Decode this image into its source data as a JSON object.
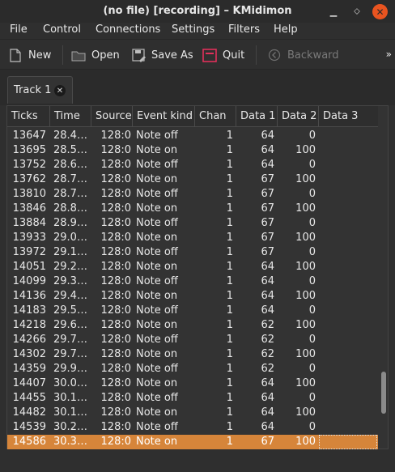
{
  "window": {
    "title": "(no file) [recording] – KMidimon"
  },
  "menu": [
    "File",
    "Control",
    "Connections",
    "Settings",
    "Filters",
    "Help"
  ],
  "toolbar": {
    "new_label": "New",
    "open_label": "Open",
    "saveas_label": "Save As",
    "quit_label": "Quit",
    "backward_label": "Backward",
    "more_label": "»"
  },
  "tab": {
    "label": "Track 1"
  },
  "table": {
    "headers": [
      "Ticks",
      "Time",
      "Source",
      "Event kind",
      "Chan",
      "Data 1",
      "Data 2",
      "Data 3"
    ],
    "rows": [
      [
        "13647",
        "28.4…",
        "128:0",
        "Note off",
        "1",
        "64",
        "0",
        ""
      ],
      [
        "13695",
        "28.5…",
        "128:0",
        "Note on",
        "1",
        "64",
        "100",
        ""
      ],
      [
        "13752",
        "28.6…",
        "128:0",
        "Note off",
        "1",
        "64",
        "0",
        ""
      ],
      [
        "13762",
        "28.7…",
        "128:0",
        "Note on",
        "1",
        "67",
        "100",
        ""
      ],
      [
        "13810",
        "28.7…",
        "128:0",
        "Note off",
        "1",
        "67",
        "0",
        ""
      ],
      [
        "13846",
        "28.8…",
        "128:0",
        "Note on",
        "1",
        "67",
        "100",
        ""
      ],
      [
        "13884",
        "28.9…",
        "128:0",
        "Note off",
        "1",
        "67",
        "0",
        ""
      ],
      [
        "13933",
        "29.0…",
        "128:0",
        "Note on",
        "1",
        "67",
        "100",
        ""
      ],
      [
        "13972",
        "29.1…",
        "128:0",
        "Note off",
        "1",
        "67",
        "0",
        ""
      ],
      [
        "14051",
        "29.2…",
        "128:0",
        "Note on",
        "1",
        "64",
        "100",
        ""
      ],
      [
        "14099",
        "29.3…",
        "128:0",
        "Note off",
        "1",
        "64",
        "0",
        ""
      ],
      [
        "14136",
        "29.4…",
        "128:0",
        "Note on",
        "1",
        "64",
        "100",
        ""
      ],
      [
        "14183",
        "29.5…",
        "128:0",
        "Note off",
        "1",
        "64",
        "0",
        ""
      ],
      [
        "14218",
        "29.6…",
        "128:0",
        "Note on",
        "1",
        "62",
        "100",
        ""
      ],
      [
        "14266",
        "29.7…",
        "128:0",
        "Note off",
        "1",
        "62",
        "0",
        ""
      ],
      [
        "14302",
        "29.7…",
        "128:0",
        "Note on",
        "1",
        "62",
        "100",
        ""
      ],
      [
        "14359",
        "29.9…",
        "128:0",
        "Note off",
        "1",
        "62",
        "0",
        ""
      ],
      [
        "14407",
        "30.0…",
        "128:0",
        "Note on",
        "1",
        "64",
        "100",
        ""
      ],
      [
        "14455",
        "30.1…",
        "128:0",
        "Note off",
        "1",
        "64",
        "0",
        ""
      ],
      [
        "14482",
        "30.1…",
        "128:0",
        "Note on",
        "1",
        "64",
        "100",
        ""
      ],
      [
        "14539",
        "30.2…",
        "128:0",
        "Note off",
        "1",
        "64",
        "0",
        ""
      ],
      [
        "14586",
        "30.3…",
        "128:0",
        "Note on",
        "1",
        "67",
        "100",
        ""
      ]
    ],
    "selected_row": 21
  },
  "colors": {
    "selection": "#d6853a",
    "close_button": "#e95420",
    "quit_icon": "#e0305a"
  }
}
